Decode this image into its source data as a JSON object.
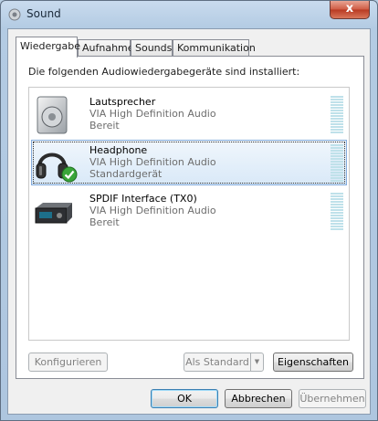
{
  "window": {
    "title": "Sound",
    "close_label": "x"
  },
  "tabs": [
    {
      "label": "Wiedergabe",
      "active": true
    },
    {
      "label": "Aufnahme",
      "active": false
    },
    {
      "label": "Sounds",
      "active": false
    },
    {
      "label": "Kommunikation",
      "active": false
    }
  ],
  "panel": {
    "caption": "Die folgenden Audiowiedergabegeräte sind installiert:",
    "devices": [
      {
        "name": "Lautsprecher",
        "driver": "VIA High Definition Audio",
        "status": "Bereit",
        "icon": "speaker-icon",
        "selected": false
      },
      {
        "name": "Headphone",
        "driver": "VIA High Definition Audio",
        "status": "Standardgerät",
        "icon": "headphone-icon",
        "selected": true
      },
      {
        "name": "SPDIF Interface (TX0)",
        "driver": "VIA High Definition Audio",
        "status": "Bereit",
        "icon": "spdif-device-icon",
        "selected": false
      }
    ],
    "buttons": {
      "configure": "Konfigurieren",
      "set_default": "Als Standard",
      "properties": "Eigenschaften"
    }
  },
  "footer": {
    "ok": "OK",
    "cancel": "Abbrechen",
    "apply": "Übernehmen"
  },
  "colors": {
    "accent": "#3c7fb1",
    "selection": "#d9e9f8",
    "meter": "#bfe1ea",
    "check": "#3aa63a"
  }
}
